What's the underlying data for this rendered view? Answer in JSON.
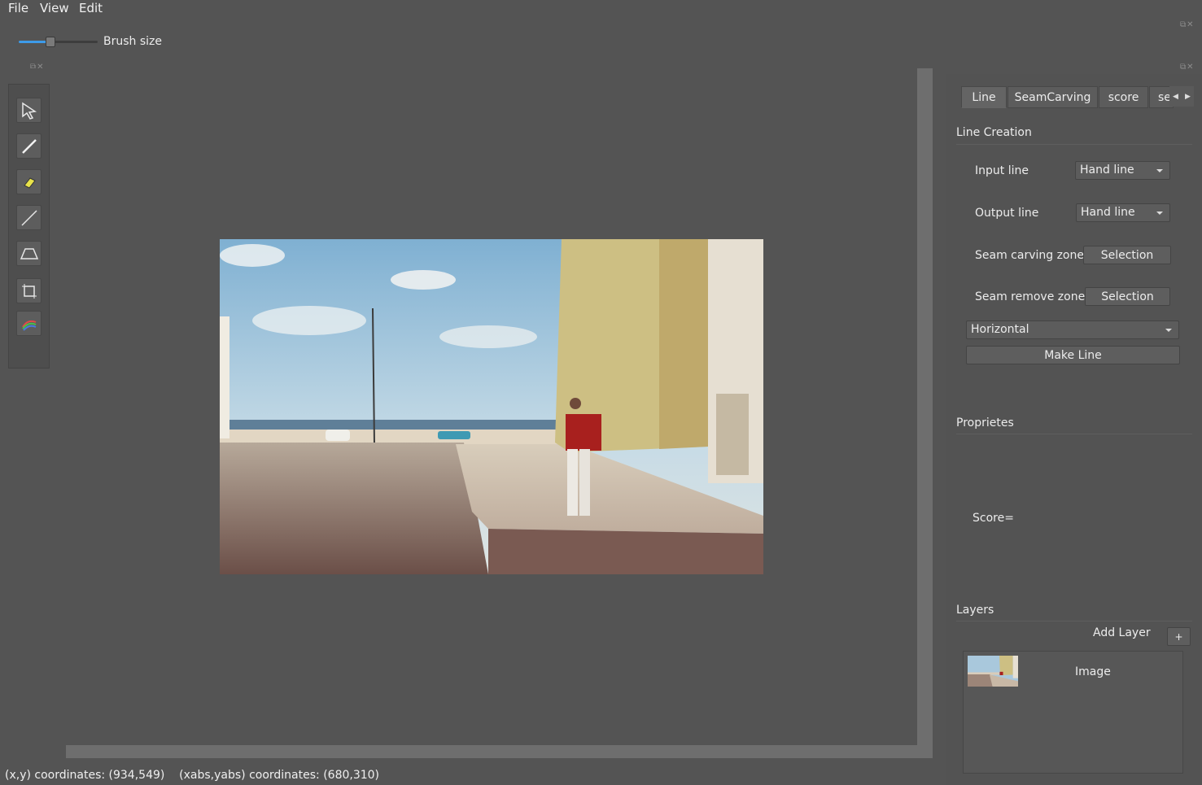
{
  "menu": [
    "File",
    "View",
    "Edit"
  ],
  "brush": {
    "label": "Brush size",
    "value_fraction": 0.4
  },
  "tools": [
    "select-arrow-icon",
    "brush-icon",
    "eraser-icon",
    "line-icon",
    "trapezoid-icon",
    "crop-icon",
    "gradient-icon"
  ],
  "tabs": [
    "Line",
    "SeamCarving",
    "score",
    "se"
  ],
  "line_creation": {
    "title": "Line Creation",
    "input_line_label": "Input line",
    "input_line_value": "Hand line",
    "output_line_label": "Output line",
    "output_line_value": "Hand line",
    "seam_carving_zone_label": "Seam carving zone",
    "seam_carving_zone_button": "Selection",
    "seam_remove_zone_label": "Seam remove zone",
    "seam_remove_zone_button": "Selection",
    "orientation_value": "Horizontal",
    "make_line_button": "Make Line"
  },
  "properties": {
    "title": "Proprietes",
    "score_label": "Score="
  },
  "layers": {
    "title": "Layers",
    "add_layer_label": "Add Layer",
    "add_button": "+",
    "items": [
      {
        "name": "Image"
      }
    ]
  },
  "status": {
    "xy": "(x,y) coordinates: (934,549)",
    "abs": "(xabs,yabs) coordinates: (680,310)"
  },
  "colors": {
    "background": "#545454",
    "slider_accent": "#3d9be9"
  }
}
